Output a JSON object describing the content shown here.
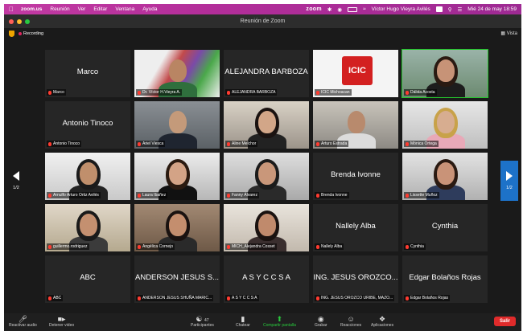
{
  "menubar": {
    "apple": "",
    "items": [
      "zoom.us",
      "Reunión",
      "Ver",
      "Editar",
      "Ventana",
      "Ayuda"
    ],
    "zoom_logo": "zoom",
    "user": "Víctor Hugo Vieyra Avilés",
    "datetime": "Mié 24 de may 18:59"
  },
  "window": {
    "title": "Reunión de Zoom"
  },
  "meeting": {
    "recording": "Recording",
    "view": "Vista",
    "page_left": "1/2",
    "page_right": "1/2",
    "tiles": [
      {
        "big": "Marco",
        "label": "Marco"
      },
      {
        "big": "",
        "label": "Dr. Víctor H.Vieyra A."
      },
      {
        "big": "ALEJANDRA BARBOZA",
        "label": "ALEJANDRA BARBOZA"
      },
      {
        "big": "",
        "label": "ICIC Michoacan",
        "logo": "ICIC"
      },
      {
        "big": "",
        "label": "Dálida Acosta"
      },
      {
        "big": "Antonio Tinoco",
        "label": "Antonio Tinoco"
      },
      {
        "big": "",
        "label": "Ariel Viesca"
      },
      {
        "big": "",
        "label": "Aline Melchor"
      },
      {
        "big": "",
        "label": "Arturo Estrada"
      },
      {
        "big": "",
        "label": "Mónica Ortega"
      },
      {
        "big": "",
        "label": "Arnulfo Arturo Ortiz Avilés"
      },
      {
        "big": "",
        "label": "Laura Ibañez"
      },
      {
        "big": "",
        "label": "Fanny Álvarez"
      },
      {
        "big": "Brenda Ivonne",
        "label": "Brenda Ivonne"
      },
      {
        "big": "",
        "label": "Lissette Muñoz"
      },
      {
        "big": "",
        "label": "guillermo.rodriguez"
      },
      {
        "big": "",
        "label": "Angélica Cornejo"
      },
      {
        "big": "",
        "label": "MICH_Alejandra Cosset"
      },
      {
        "big": "Nallely Alba",
        "label": "Nallely Alba"
      },
      {
        "big": "Cynthia",
        "label": "Cynthia"
      },
      {
        "big": "ABC",
        "label": "ABC"
      },
      {
        "big": "ANDERSON JESUS S...",
        "label": "ANDERSON JESUS SHUÑA MARIC..."
      },
      {
        "big": "A S Y C C S A",
        "label": "A S Y C C S A"
      },
      {
        "big": "ING. JESUS OROZCO...",
        "label": "ING. JESUS OROZCO URIBE, MAZO..."
      },
      {
        "big": "Edgar Bolaños Rojas",
        "label": "Edgar Bolaños Rojas"
      }
    ]
  },
  "toolbar": {
    "audio": "Reactivar audio",
    "video": "Detener video",
    "participants": "Participantes",
    "participants_count": "47",
    "chat": "Chatear",
    "share": "Compartir pantalla",
    "record": "Grabar",
    "reactions": "Reacciones",
    "apps": "Aplicaciones",
    "leave": "Salir"
  },
  "colors": {
    "menubar": "#b32e9a",
    "active_speaker": "#25c42d",
    "leave": "#e02b2b",
    "share": "#29c93d"
  }
}
